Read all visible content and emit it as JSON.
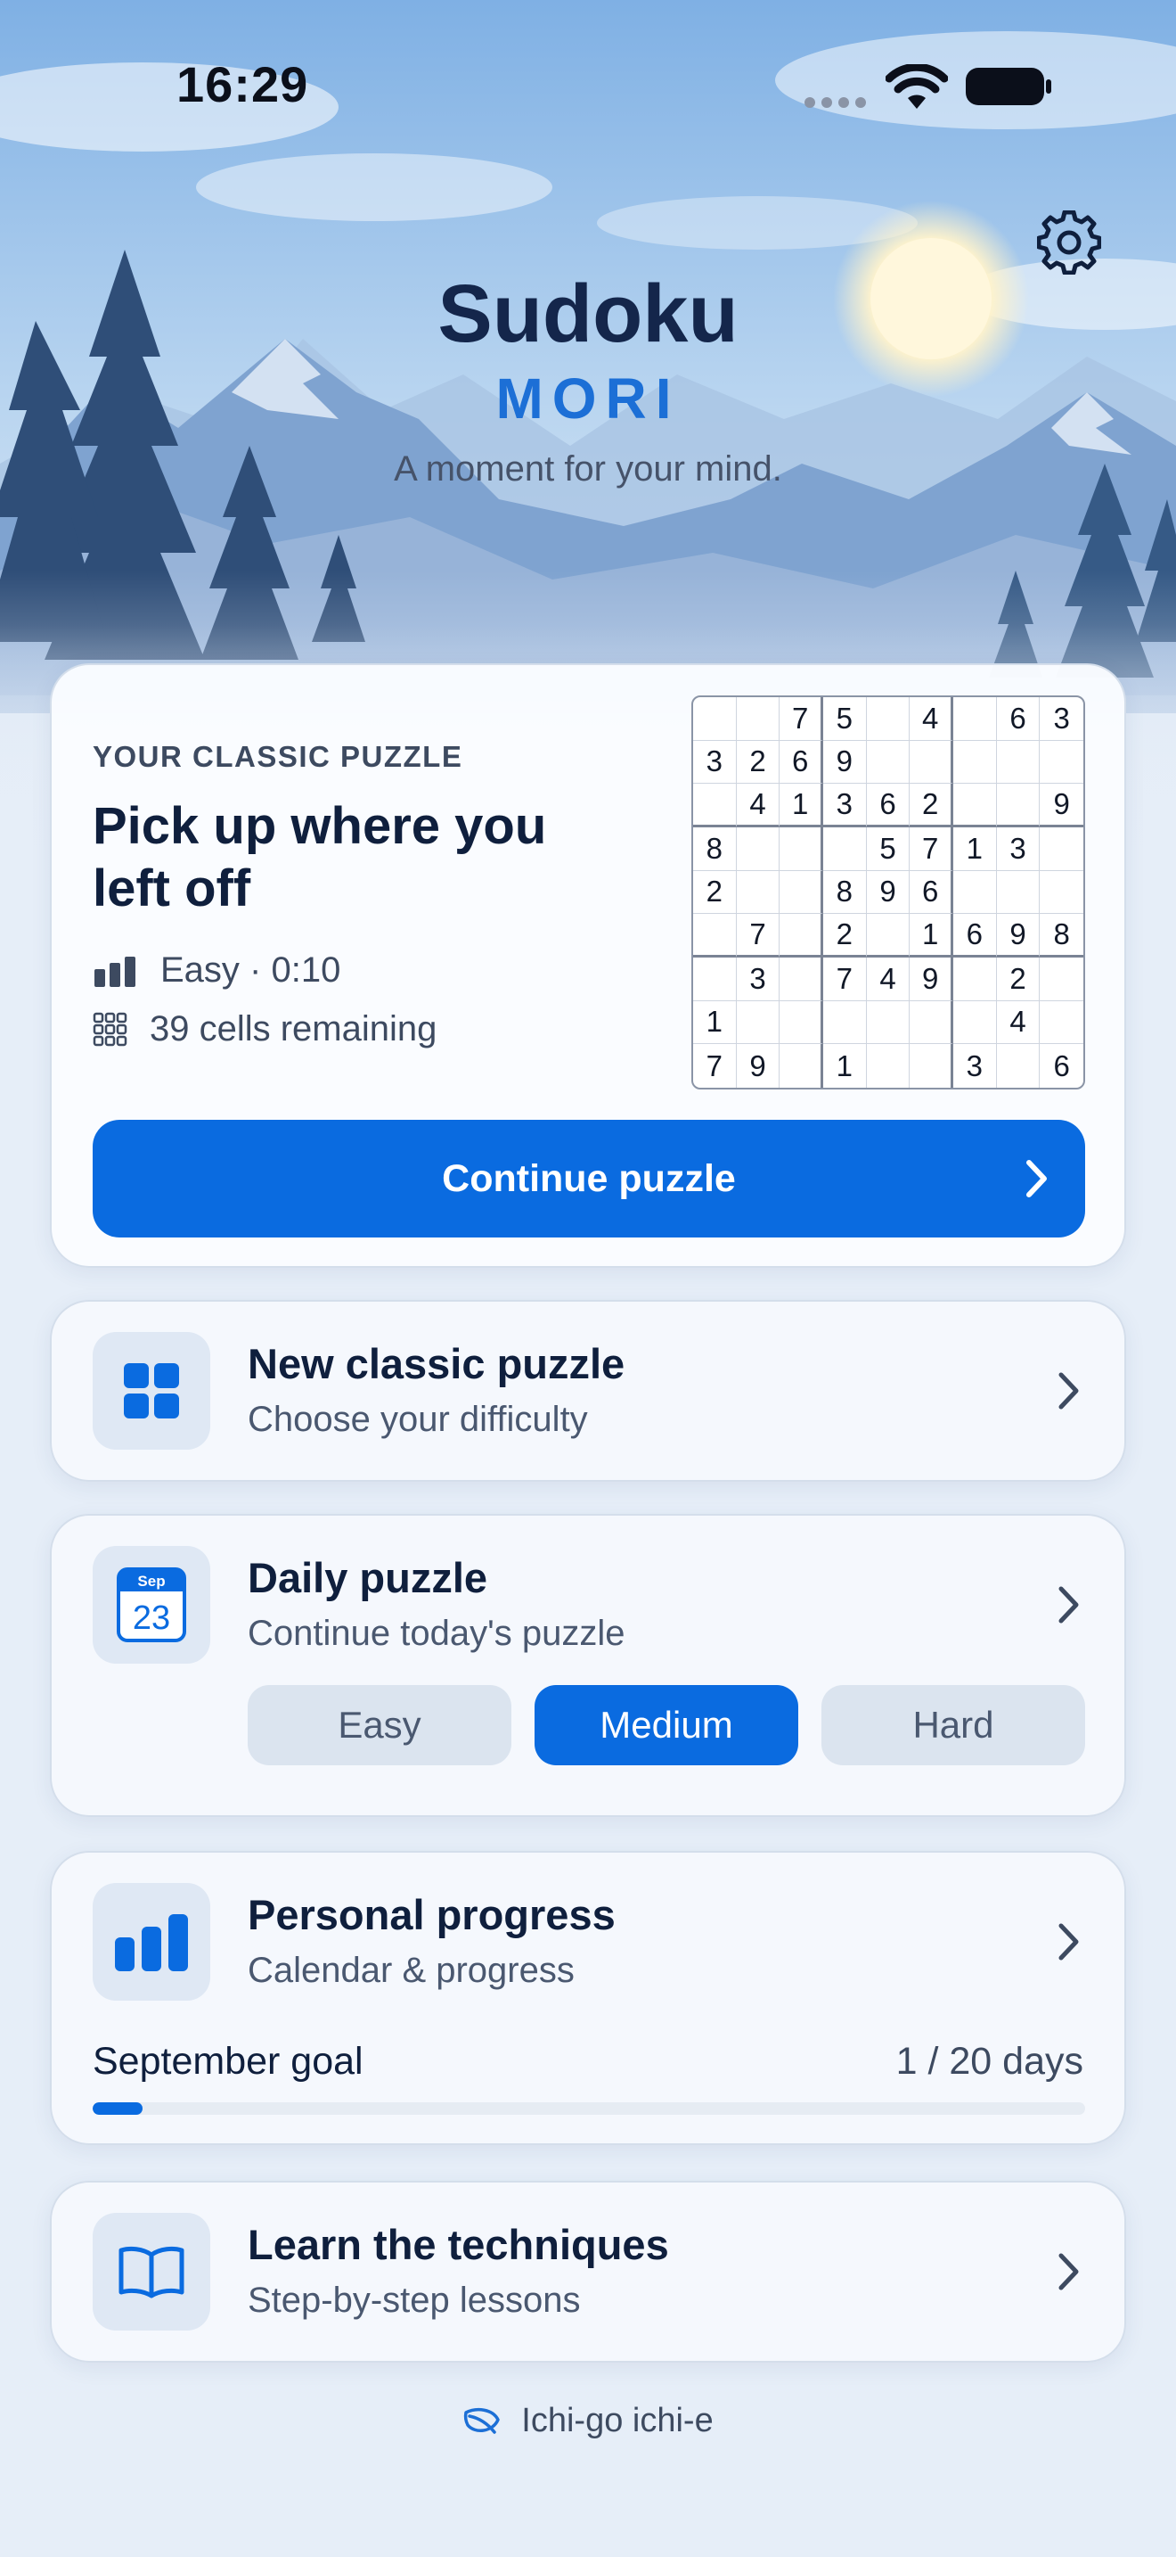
{
  "status_bar": {
    "time": "16:29"
  },
  "header": {
    "title": "Sudoku",
    "subtitle": "MORI",
    "tagline": "A moment for your mind."
  },
  "classic_card": {
    "eyebrow": "YOUR CLASSIC PUZZLE",
    "headline": "Pick up where you left off",
    "difficulty_time": "Easy · 0:10",
    "cells_remaining": "39 cells remaining",
    "continue_label": "Continue puzzle",
    "grid": [
      [
        "",
        "",
        "7",
        "5",
        "",
        "4",
        "",
        "6",
        "3"
      ],
      [
        "3",
        "2",
        "6",
        "9",
        "",
        "",
        "",
        "",
        ""
      ],
      [
        "",
        "4",
        "1",
        "3",
        "6",
        "2",
        "",
        "",
        "9"
      ],
      [
        "8",
        "",
        "",
        "",
        "5",
        "7",
        "1",
        "3",
        ""
      ],
      [
        "2",
        "",
        "",
        "8",
        "9",
        "6",
        "",
        "",
        ""
      ],
      [
        "",
        "7",
        "",
        "2",
        "",
        "1",
        "6",
        "9",
        "8"
      ],
      [
        "",
        "3",
        "",
        "7",
        "4",
        "9",
        "",
        "2",
        ""
      ],
      [
        "1",
        "",
        "",
        "",
        "",
        "",
        "",
        "4",
        ""
      ],
      [
        "7",
        "9",
        "",
        "1",
        "",
        "",
        "3",
        "",
        "6"
      ]
    ]
  },
  "new_puzzle": {
    "title": "New classic puzzle",
    "subtitle": "Choose your difficulty"
  },
  "daily_puzzle": {
    "title": "Daily puzzle",
    "subtitle": "Continue today's puzzle",
    "calendar_month": "Sep",
    "calendar_day": "23",
    "difficulties": [
      "Easy",
      "Medium",
      "Hard"
    ],
    "selected": "Medium"
  },
  "progress": {
    "title": "Personal progress",
    "subtitle": "Calendar & progress",
    "goal_label": "September goal",
    "goal_value": "1 / 20 days",
    "goal_fraction": 0.05
  },
  "learn": {
    "title": "Learn the techniques",
    "subtitle": "Step-by-step lessons"
  },
  "footer": {
    "text": "Ichi-go ichi-e"
  },
  "colors": {
    "accent": "#0a6be0",
    "title": "#14264b",
    "subtitle": "#1c6fd6"
  },
  "icons": {
    "settings": "gear-icon",
    "difficulty": "signal-bars-icon",
    "cells": "grid-dots-icon",
    "new_puzzle": "four-squares-icon",
    "daily": "calendar-icon",
    "progress": "bar-chart-icon",
    "learn": "open-book-icon",
    "footer": "leaf-icon",
    "chevron": "chevron-right-icon"
  }
}
